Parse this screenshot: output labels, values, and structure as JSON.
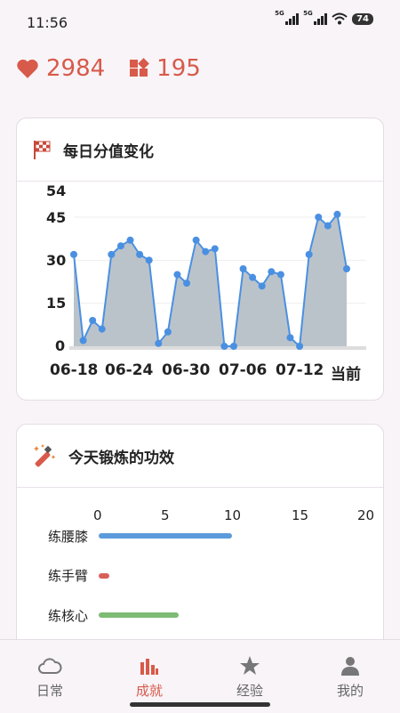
{
  "status": {
    "time": "11:56",
    "battery": "74",
    "net1": "5G",
    "net2": "5G"
  },
  "stats": {
    "likes": "2984",
    "blocks": "195"
  },
  "score_card": {
    "title": "每日分值变化",
    "y_ticks": [
      "54",
      "45",
      "30",
      "15",
      "0"
    ],
    "x_ticks": [
      "06-18",
      "06-24",
      "06-30",
      "07-06",
      "07-12",
      "当前"
    ]
  },
  "effect_card": {
    "title": "今天锻炼的功效",
    "x_ticks": [
      "0",
      "5",
      "10",
      "15",
      "20"
    ],
    "bars": [
      {
        "label": "练腰膝",
        "value": 10,
        "color": "#5b9bdc"
      },
      {
        "label": "练手臂",
        "value": 0.8,
        "color": "#d9605a"
      },
      {
        "label": "练核心",
        "value": 6,
        "color": "#7dbb74"
      }
    ]
  },
  "chart_data": [
    {
      "type": "area",
      "title": "每日分值变化",
      "x": [
        "06-18",
        "06-19",
        "06-20",
        "06-21",
        "06-22",
        "06-23",
        "06-24",
        "06-25",
        "06-26",
        "06-27",
        "06-28",
        "06-29",
        "06-30",
        "07-01",
        "07-02",
        "07-03",
        "07-04",
        "07-05",
        "07-06",
        "07-07",
        "07-08",
        "07-09",
        "07-10",
        "07-11",
        "07-12",
        "07-13",
        "07-14",
        "07-15",
        "07-16",
        "当前"
      ],
      "values": [
        32,
        2,
        9,
        6,
        32,
        35,
        37,
        32,
        30,
        1,
        5,
        25,
        22,
        37,
        33,
        34,
        0,
        0,
        27,
        24,
        21,
        26,
        25,
        3,
        0,
        32,
        45,
        42,
        46,
        27
      ],
      "x_tick_labels": [
        "06-18",
        "06-24",
        "06-30",
        "07-06",
        "07-12",
        "当前"
      ],
      "y_tick_labels": [
        "0",
        "15",
        "30",
        "45",
        "54"
      ],
      "ylim": [
        0,
        54
      ],
      "line_color": "#4a90e2",
      "fill_color": "#b4bcc4"
    },
    {
      "type": "bar",
      "orientation": "horizontal",
      "title": "今天锻炼的功效",
      "categories": [
        "练腰膝",
        "练手臂",
        "练核心"
      ],
      "values": [
        10,
        0.8,
        6
      ],
      "xlim": [
        0,
        20
      ],
      "colors": [
        "#5b9bdc",
        "#d9605a",
        "#7dbb74"
      ]
    }
  ],
  "tabs": [
    {
      "label": "日常",
      "icon": "cloud-icon"
    },
    {
      "label": "成就",
      "icon": "bar-chart-icon",
      "active": true
    },
    {
      "label": "经验",
      "icon": "star-icon"
    },
    {
      "label": "我的",
      "icon": "person-icon"
    }
  ]
}
